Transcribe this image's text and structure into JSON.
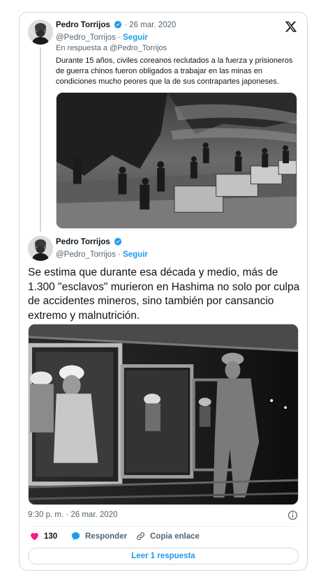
{
  "parent_tweet": {
    "author_name": "Pedro Torrijos",
    "date": "· 26 mar. 2020",
    "handle": "@Pedro_Torrijos",
    "separator": "·",
    "follow_label": "Seguir",
    "reply_prefix": "En respuesta a",
    "reply_to": "@Pedro_Torrijos",
    "text": "Durante 15 años, civiles coreanos reclutados a la fuerza y prisioneros de guerra chinos fueron obligados a trabajar en las minas en condiciones mucho peores que la de sus contrapartes japoneses."
  },
  "main_tweet": {
    "author_name": "Pedro Torrijos",
    "handle": "@Pedro_Torrijos",
    "separator": "·",
    "follow_label": "Seguir",
    "text": "Se estima que durante esa década y medio, más de 1.300 \"esclavos\" murieron en Hashima no solo por culpa de accidentes mineros, sino también por cansancio extremo y malnutrición.",
    "timestamp": "9:30 p. m. · 26 mar. 2020",
    "like_count": "130",
    "reply_label": "Responder",
    "copy_link_label": "Copia enlace",
    "read_replies_label": "Leer 1 respuesta"
  },
  "icons": {
    "platform": "x-logo-icon",
    "verified": "verified-badge-icon",
    "like": "heart-icon",
    "reply": "reply-bubble-icon",
    "copy": "link-icon",
    "info": "info-icon"
  },
  "colors": {
    "accent": "#1d9bf0",
    "like": "#f91880",
    "text": "#0f1419",
    "muted": "#536471",
    "border": "#cfd9de"
  }
}
